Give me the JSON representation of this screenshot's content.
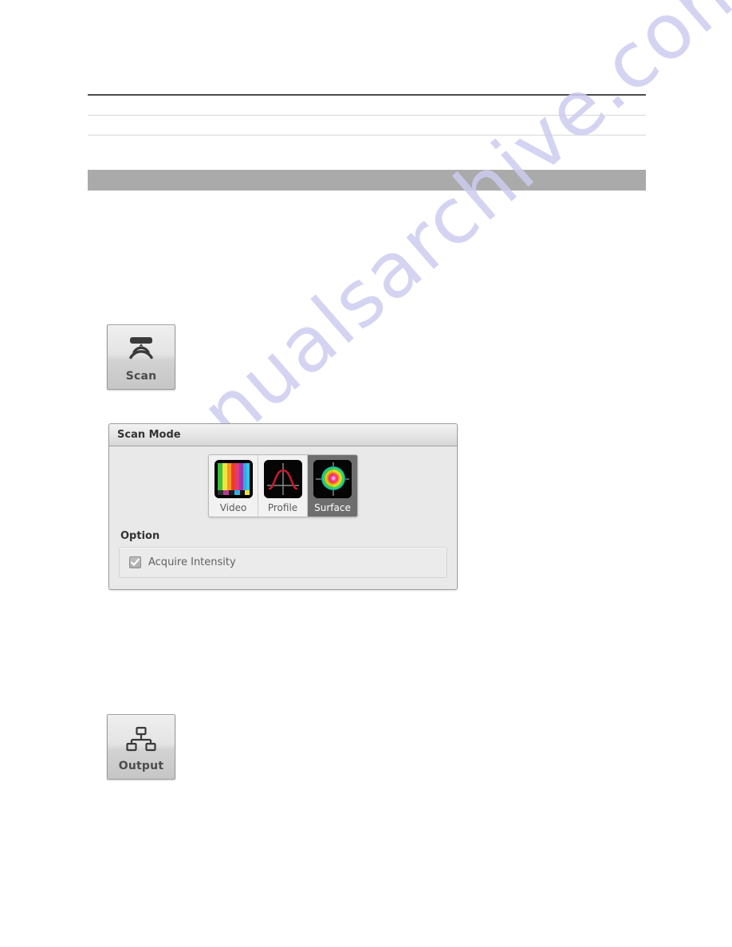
{
  "document": {
    "watermark_text": "manualsarchive.com",
    "background_color": "#ffffff"
  },
  "header": {
    "rule_top_color": "#4a4a4f",
    "rule_light_color": "#d8d8d8",
    "section_bar_color": "#aaaaaa"
  },
  "toolbar": {
    "scan": {
      "label": "Scan",
      "icon": "scan-sensor-icon"
    },
    "output": {
      "label": "Output",
      "icon": "network-tree-icon"
    }
  },
  "scan_mode_panel": {
    "title": "Scan Mode",
    "modes": [
      {
        "label": "Video",
        "icon": "color-bars-icon",
        "selected": false
      },
      {
        "label": "Profile",
        "icon": "bell-curve-icon",
        "selected": false
      },
      {
        "label": "Surface",
        "icon": "surface-heatmap-icon",
        "selected": true
      }
    ],
    "selected_mode": "Surface",
    "option_group": {
      "title": "Option",
      "checkbox": {
        "label": "Acquire Intensity",
        "checked": true,
        "enabled": false
      }
    },
    "colors": {
      "selected_cell": "#6e6e6e",
      "panel_background": "#e9e9e9",
      "header_border": "#a0a0a0"
    }
  }
}
